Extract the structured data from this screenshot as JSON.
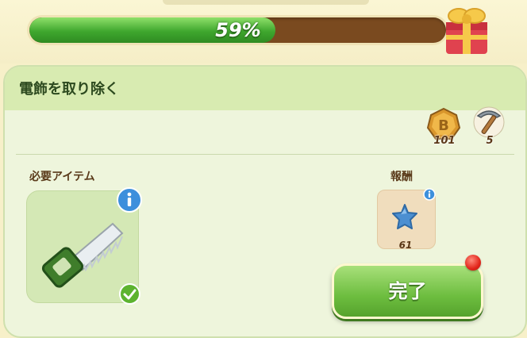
{
  "progress": {
    "percent_label": "59%",
    "fraction": 0.59,
    "fill_color": "#4cb33a",
    "track_color": "#7a4a1f"
  },
  "quest": {
    "title": "電飾を取り除く"
  },
  "currencies": [
    {
      "icon": "coin-icon",
      "count": "101"
    },
    {
      "icon": "pickaxe-icon",
      "count": "5"
    }
  ],
  "required": {
    "label": "必要アイテム",
    "item_icon": "saw-icon",
    "status": "check-icon"
  },
  "reward": {
    "label": "報酬",
    "icon": "blue-star-icon",
    "count": "61"
  },
  "complete_button": {
    "label": "完了"
  },
  "colors": {
    "button_green": "#6dbd3f",
    "panel_bg": "#eef5dc",
    "notification_red": "#e2261b"
  }
}
